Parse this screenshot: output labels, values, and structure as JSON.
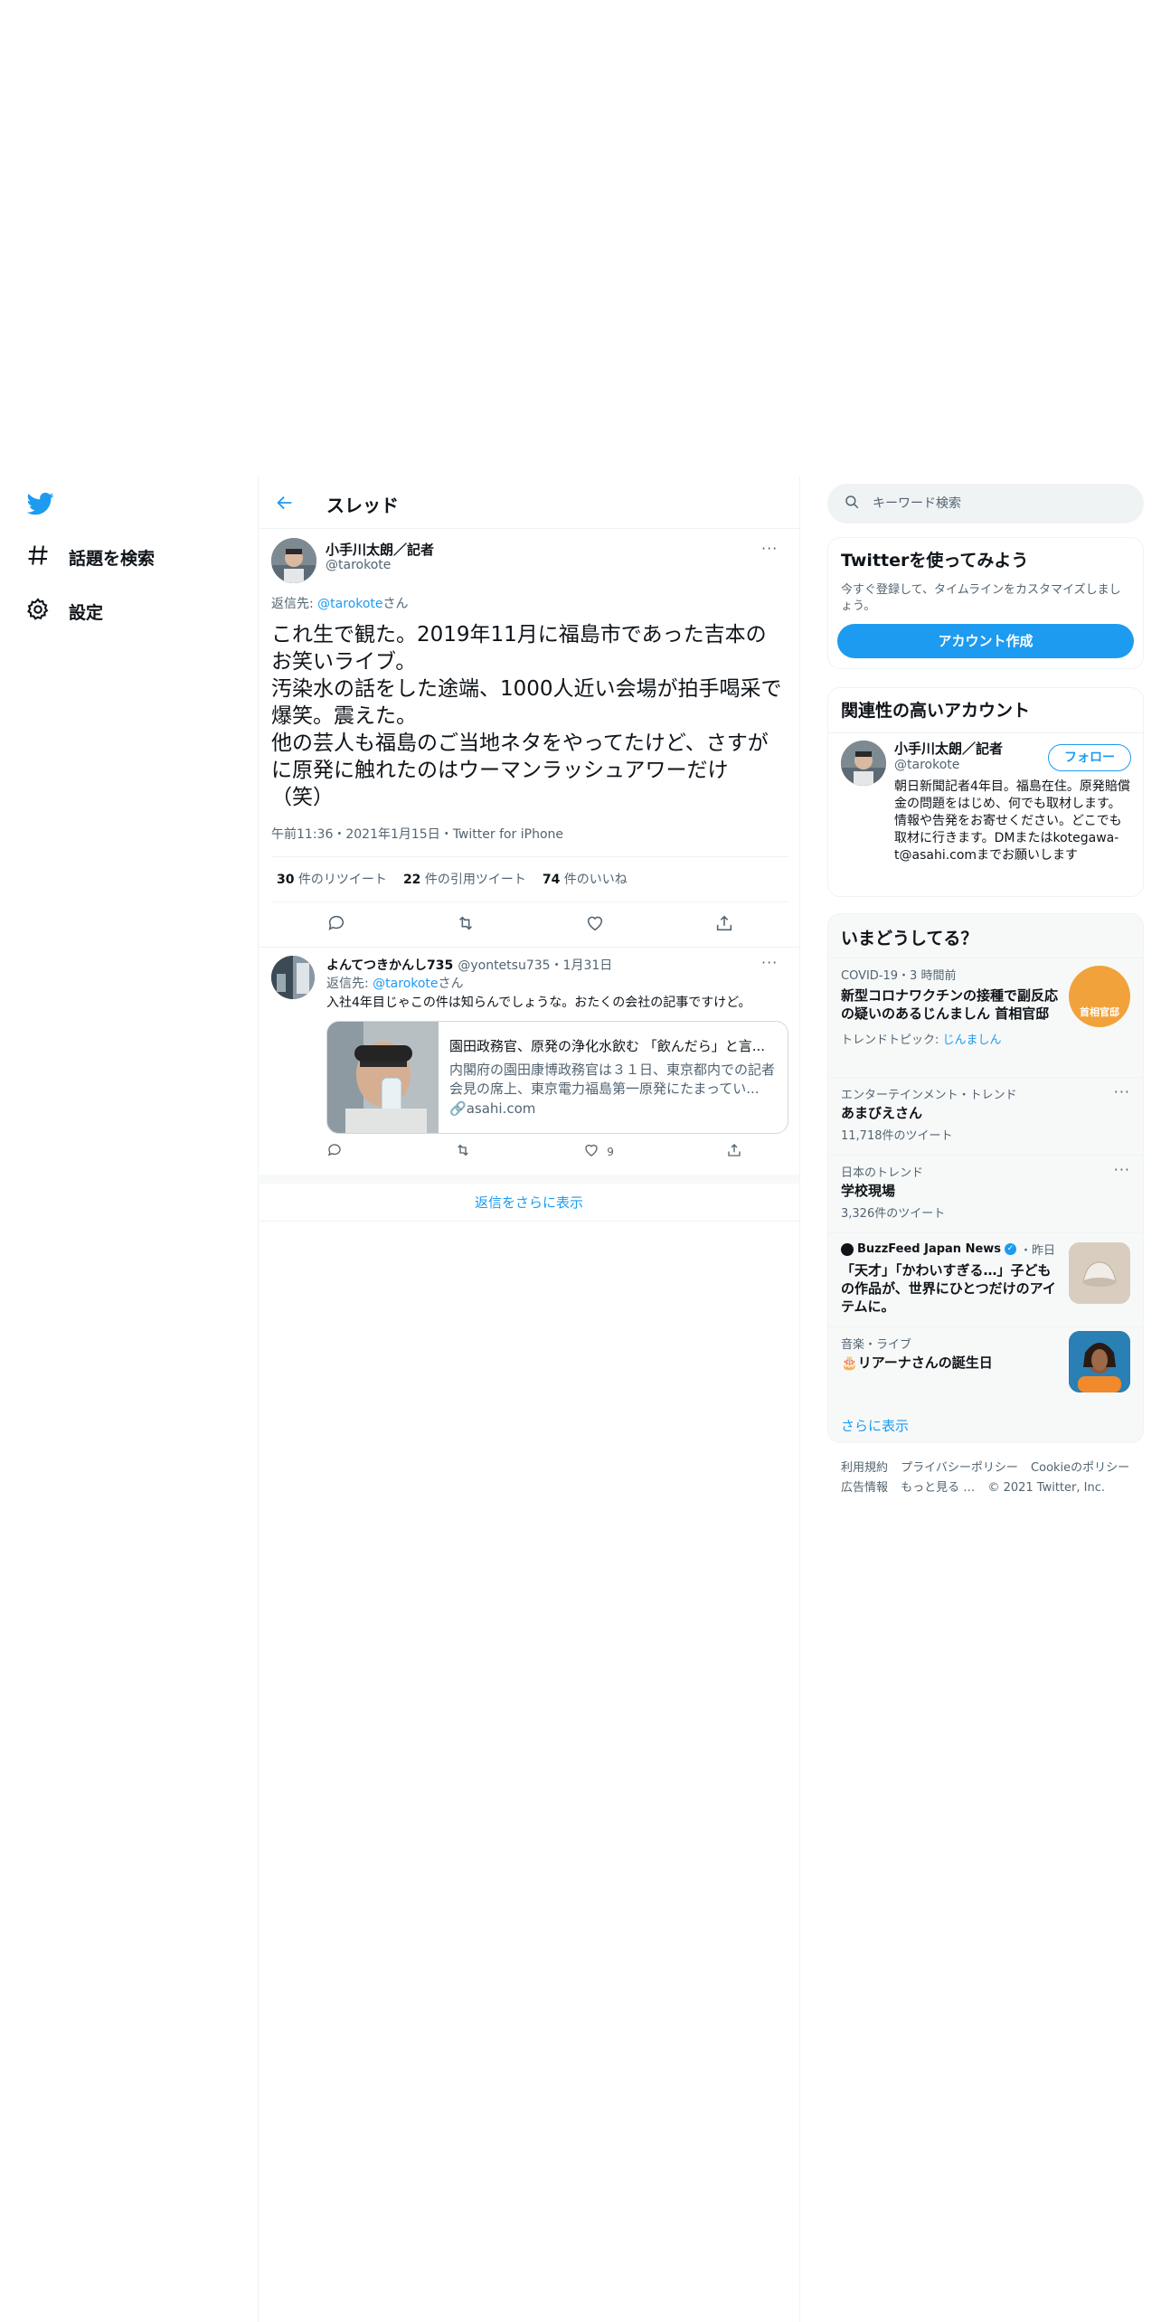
{
  "nav": {
    "items": [
      {
        "label": "話題を検索",
        "icon": "hashtag-icon"
      },
      {
        "label": "設定",
        "icon": "gear-icon"
      }
    ]
  },
  "header": {
    "title": "スレッド"
  },
  "main_tweet": {
    "author_name": "小手川太朗／記者",
    "author_handle": "@tarokote",
    "reply_prefix": "返信先: ",
    "reply_handle": "@tarokote",
    "reply_suffix": "さん",
    "text_lines": [
      "これ生で観た。2019年11月に福島市であった吉本の",
      "お笑いライブ。",
      "汚染水の話をした途端、1000人近い会場が拍手喝采で",
      "爆笑。震えた。",
      "他の芸人も福島のご当地ネタをやってたけど、さすが",
      "に原発に触れたのはウーマンラッシュアワーだけ",
      "（笑）"
    ],
    "meta": "午前11:36・2021年1月15日・Twitter for iPhone",
    "stats": [
      {
        "count": "30",
        "label": " 件のリツイート"
      },
      {
        "count": "22",
        "label": " 件の引用ツイート"
      },
      {
        "count": "74",
        "label": " 件のいいね"
      }
    ]
  },
  "reply_tweet": {
    "author_name": "よんてつきかんし735",
    "author_handle": "@yontetsu735",
    "date": "・1月31日",
    "reply_prefix": "返信先: ",
    "reply_handle": "@tarokote",
    "reply_suffix": "さん",
    "text": "入社4年目じゃこの件は知らんでしょうな。おたくの会社の記事ですけど。",
    "card": {
      "title": "園田政務官、原発の浄化水飲む 「飲んだら」と言...",
      "description": "内閣府の園田康博政務官は３１日、東京都内での記者会見の席上、東京電力福島第一原発にたまってい...",
      "domain": "asahi.com"
    },
    "like_count": "9"
  },
  "show_more_replies": "返信をさらに表示",
  "search": {
    "placeholder": "キーワード検索"
  },
  "signup_panel": {
    "title": "Twitterを使ってみよう",
    "subtitle": "今すぐ登録して、タイムラインをカスタマイズしましょう。",
    "button": "アカウント作成"
  },
  "related_panel": {
    "title": "関連性の高いアカウント",
    "account": {
      "name": "小手川太朗／記者",
      "handle": "@tarokote",
      "follow": "フォロー",
      "bio": "朝日新聞記者4年目。福島在住。原発賠償金の問題をはじめ、何でも取材します。情報や告発をお寄せください。どこでも取材に行きます。DMまたはkotegawa-t@asahi.comまでお願いします"
    }
  },
  "trends_panel": {
    "title": "いまどうしてる？",
    "items": [
      {
        "meta": "COVID-19・3 時間前",
        "title": "新型コロナワクチンの接種で副反応の疑いのあるじんましん 首相官邸",
        "extra_prefix": "トレンドトピック: ",
        "extra_link": "じんましん"
      },
      {
        "meta": "エンターテインメント・トレンド",
        "title": "あまびえさん",
        "count": "11,718件のツイート"
      },
      {
        "meta": "日本のトレンド",
        "title": "学校現場",
        "count": "3,326件のツイート"
      },
      {
        "source": "BuzzFeed Japan News",
        "time": "・昨日",
        "title": "「天才」「かわいすぎる…」子どもの作品が、世界にひとつだけのアイテムに。"
      },
      {
        "meta": "音楽・ライブ",
        "emoji": "🎂",
        "title": "リアーナさんの誕生日"
      }
    ],
    "show_more": "さらに表示",
    "badge_text": "首相官邸"
  },
  "footer": {
    "links": [
      "利用規約",
      "プライバシーポリシー",
      "Cookieのポリシー",
      "広告情報",
      "もっと見る …"
    ],
    "copyright": "© 2021 Twitter, Inc."
  },
  "colors": {
    "accent": "#1d9bf0",
    "text": "#0f1419",
    "muted": "#536471",
    "border": "#eff3f4"
  }
}
